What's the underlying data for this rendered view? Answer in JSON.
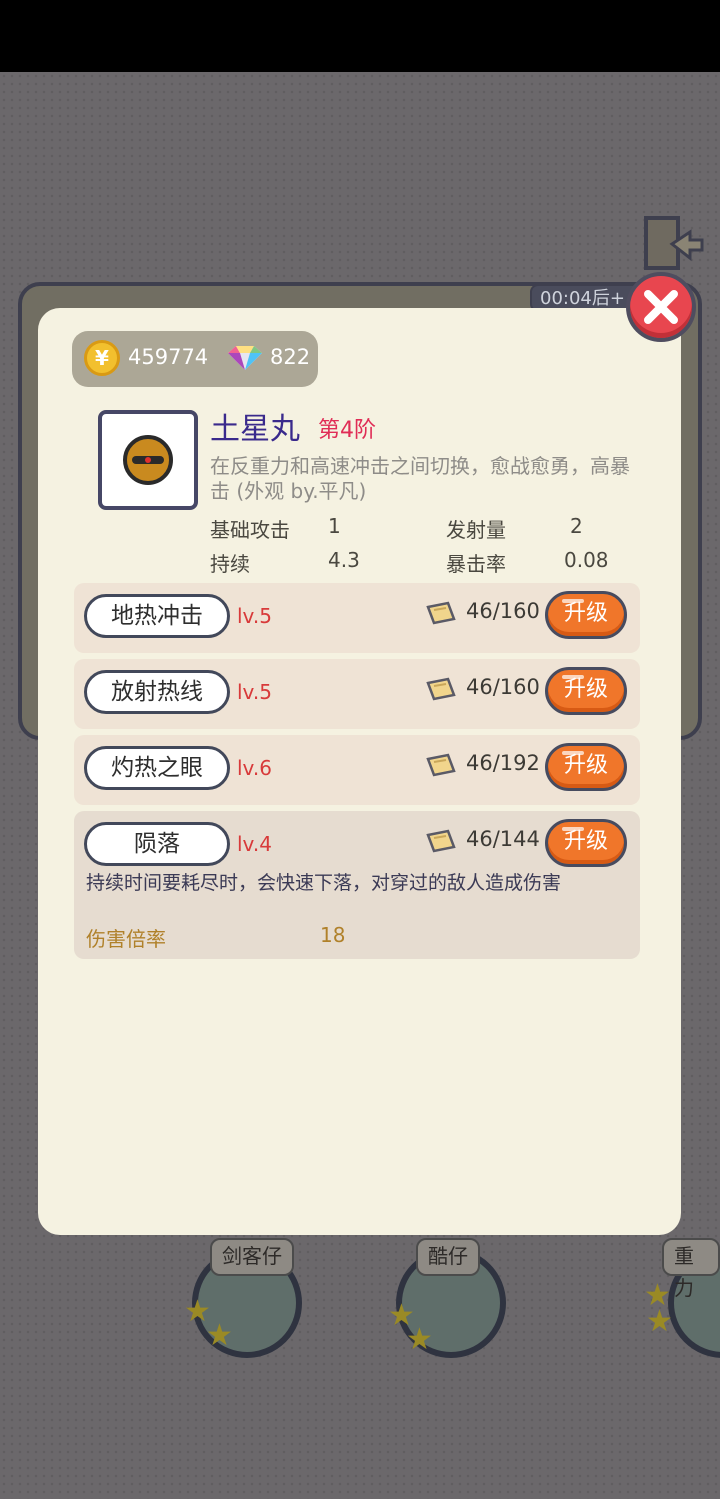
{
  "background": {
    "timer": "00:04后+",
    "characters": [
      {
        "name": "剑客仔"
      },
      {
        "name": "酷仔"
      },
      {
        "name": "重力"
      }
    ]
  },
  "currency": {
    "coins": "459774",
    "gems": "822"
  },
  "weapon": {
    "name": "土星丸",
    "tier": "第4阶",
    "description": "在反重力和高速冲击之间切换，愈战愈勇，高暴击 (外观 by.平凡)",
    "stats": {
      "attack_label": "基础攻击",
      "attack_value": "1",
      "shots_label": "发射量",
      "shots_value": "2",
      "duration_label": "持续",
      "duration_value": "4.3",
      "crit_label": "暴击率",
      "crit_value": "0.08"
    }
  },
  "skills": [
    {
      "name": "地热冲击",
      "level": "lv.5",
      "cost": "46/160",
      "button": "升级"
    },
    {
      "name": "放射热线",
      "level": "lv.5",
      "cost": "46/160",
      "button": "升级"
    },
    {
      "name": "灼热之眼",
      "level": "lv.6",
      "cost": "46/192",
      "button": "升级"
    },
    {
      "name": "陨落",
      "level": "lv.4",
      "cost": "46/144",
      "button": "升级",
      "description": "持续时间要耗尽时，会快速下落，对穿过的敌人造成伤害",
      "param_label": "伤害倍率",
      "param_value": "18"
    }
  ],
  "icons": {
    "close": "close-icon",
    "coin": "coin-icon",
    "gem": "gem-icon",
    "scroll": "scroll-icon"
  },
  "colors": {
    "upgrade_button": "#f0762a",
    "close_button": "#e8464f",
    "weapon_name": "#3a2a8c",
    "level_text": "#d83a3a"
  }
}
